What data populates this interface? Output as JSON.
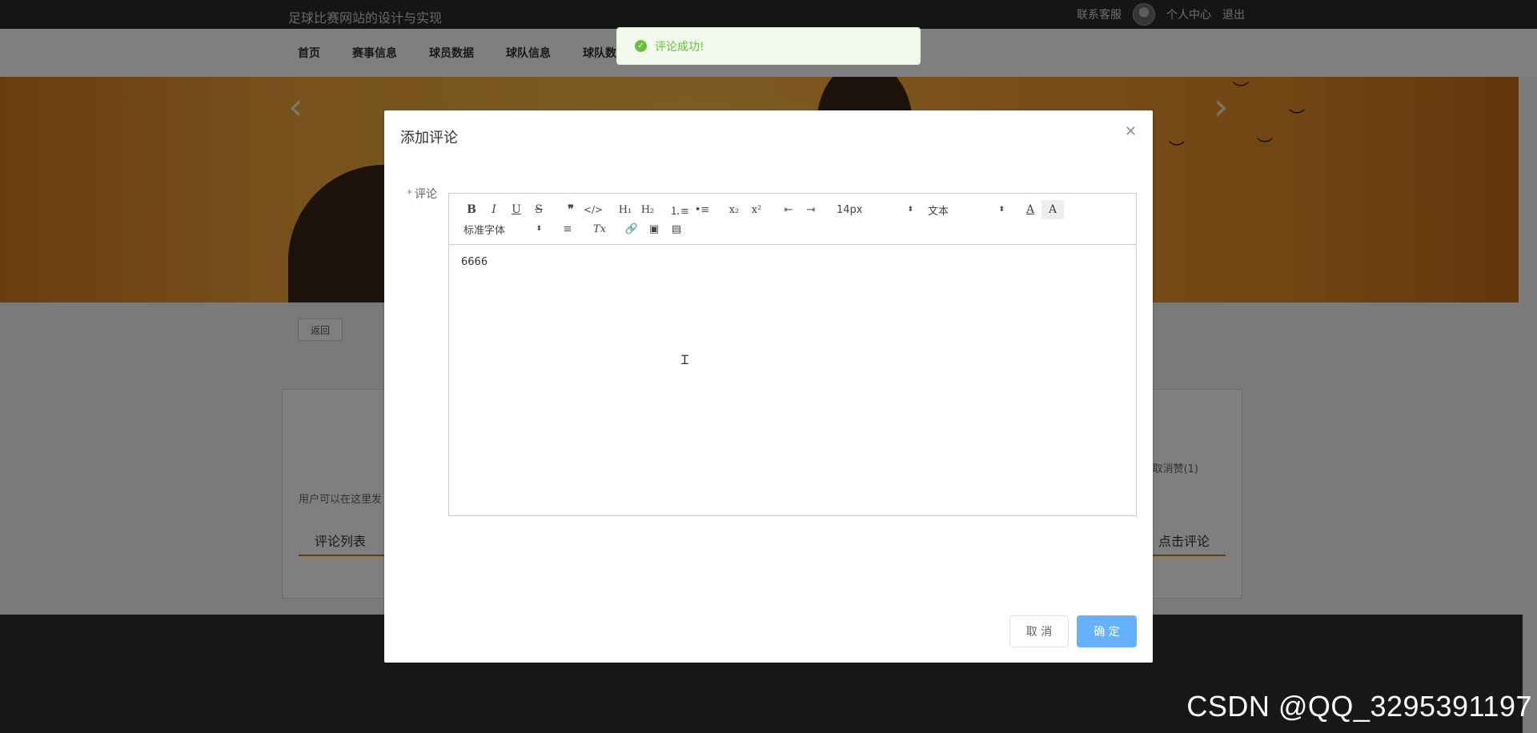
{
  "header": {
    "site_title": "足球比赛网站的设计与实现",
    "contact": "联系客服",
    "profile": "个人中心",
    "logout": "退出"
  },
  "nav": {
    "items": [
      "首页",
      "赛事信息",
      "球员数据",
      "球队信息",
      "球队数"
    ]
  },
  "banner": {
    "prev_arrow": "‹",
    "next_arrow": "›"
  },
  "page": {
    "back_label": "返回",
    "description": "用户可以在这里发",
    "like_text": "取消赞(1)",
    "tab_comment_list": "评论列表",
    "tab_add_comment": "点击评论"
  },
  "toast": {
    "message": "评论成功!",
    "color": "#67c23a"
  },
  "dialog": {
    "title": "添加评论",
    "field_label": "评论",
    "editor": {
      "font_size": "14px",
      "block_type": "文本",
      "font_family": "标准字体",
      "content": "6666"
    },
    "cancel_label": "取 消",
    "confirm_label": "确 定",
    "accent": "#66b1ff"
  },
  "watermark": "CSDN @QQ_3295391197"
}
